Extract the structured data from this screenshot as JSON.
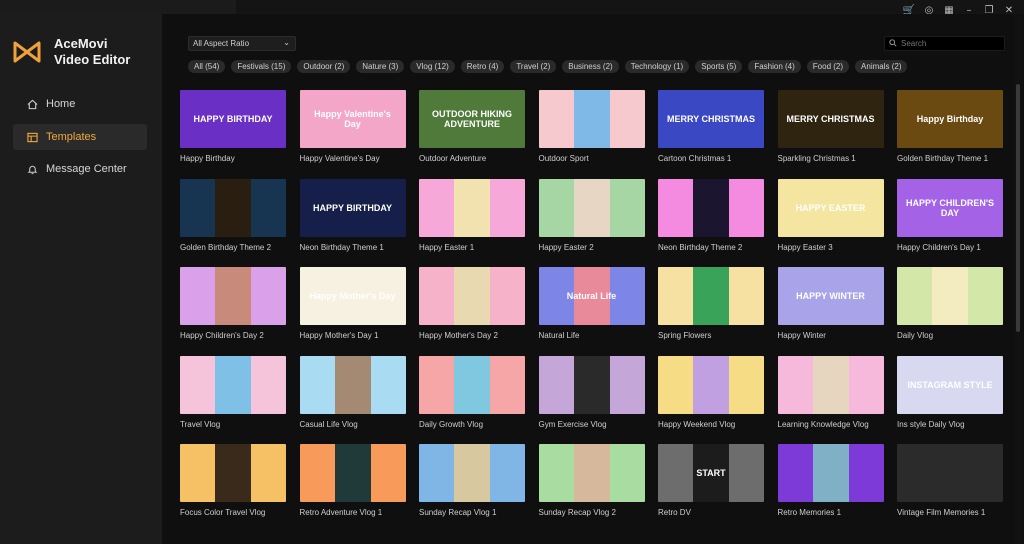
{
  "app": {
    "name_line1": "AceMovi",
    "name_line2": "Video Editor",
    "brand_color": "#f0a23a"
  },
  "window_controls": [
    "cart-icon",
    "account-icon",
    "grid-icon",
    "minimize-icon",
    "restore-icon",
    "close-icon"
  ],
  "sidebar": {
    "items": [
      {
        "label": "Home",
        "icon": "home-icon"
      },
      {
        "label": "Templates",
        "icon": "template-icon",
        "active": true
      },
      {
        "label": "Message Center",
        "icon": "bell-icon"
      }
    ]
  },
  "toolbar": {
    "aspect_ratio": "All Aspect Ratio",
    "search_placeholder": "Search"
  },
  "filters": [
    "All (54)",
    "Festivals (15)",
    "Outdoor (2)",
    "Nature (3)",
    "Vlog (12)",
    "Retro (4)",
    "Travel (2)",
    "Business (2)",
    "Technology (1)",
    "Sports (5)",
    "Fashion (4)",
    "Food (2)",
    "Animals (2)"
  ],
  "templates": [
    {
      "label": "Happy Birthday",
      "bg": "#6a2fc4",
      "center": null,
      "title": "HAPPY BIRTHDAY"
    },
    {
      "label": "Happy Valentine's Day",
      "bg": "#f3a6c8",
      "center": null,
      "title": "Happy Valentine's Day"
    },
    {
      "label": "Outdoor Adventure",
      "bg": "#4f7a3a",
      "center": null,
      "title": "OUTDOOR HIKING ADVENTURE"
    },
    {
      "label": "Outdoor Sport",
      "bg": "#f6c9cf",
      "center": "#7fb9e8",
      "title": ""
    },
    {
      "label": "Cartoon Christmas 1",
      "bg": "#3a48c4",
      "center": null,
      "title": "MERRY CHRISTMAS"
    },
    {
      "label": "Sparkling Christmas 1",
      "bg": "#2e2410",
      "center": null,
      "title": "MERRY CHRISTMAS"
    },
    {
      "label": "Golden Birthday Theme 1",
      "bg": "#6b4a12",
      "center": null,
      "title": "Happy Birthday"
    },
    {
      "label": "Golden Birthday Theme 2",
      "bg": "#173450",
      "center": "#2a1e10",
      "title": ""
    },
    {
      "label": "Neon Birthday Theme 1",
      "bg": "#151f4a",
      "center": null,
      "title": "HAPPY BIRTHDAY"
    },
    {
      "label": "Happy Easter 1",
      "bg": "#f6a9d9",
      "center": "#f2e2b0",
      "title": ""
    },
    {
      "label": "Happy Easter 2",
      "bg": "#a7d6a5",
      "center": "#e8d6c4",
      "title": ""
    },
    {
      "label": "Neon Birthday Theme 2",
      "bg": "#f58be0",
      "center": "#1c1530",
      "title": ""
    },
    {
      "label": "Happy Easter 3",
      "bg": "#f4e6a0",
      "center": null,
      "title": "HAPPY EASTER"
    },
    {
      "label": "Happy Children's Day 1",
      "bg": "#a463e6",
      "center": null,
      "title": "HAPPY CHILDREN'S DAY"
    },
    {
      "label": "Happy Children's Day 2",
      "bg": "#dba0ea",
      "center": "#c88a7a",
      "title": ""
    },
    {
      "label": "Happy Mother's Day 1",
      "bg": "#f6f1e0",
      "center": null,
      "title": "Happy Mother's Day"
    },
    {
      "label": "Happy Mother's Day 2",
      "bg": "#f6b2c8",
      "center": "#e9d9b0",
      "title": ""
    },
    {
      "label": "Natural Life",
      "bg": "#7d86e6",
      "center": "#e98a9a",
      "title": "Natural Life"
    },
    {
      "label": "Spring Flowers",
      "bg": "#f6e1a2",
      "center": "#3aa35a",
      "title": ""
    },
    {
      "label": "Happy Winter",
      "bg": "#a9a4ea",
      "center": null,
      "title": "HAPPY WINTER"
    },
    {
      "label": "Daily Vlog",
      "bg": "#d3e8a8",
      "center": "#f2ecc0",
      "title": ""
    },
    {
      "label": "Travel Vlog",
      "bg": "#f5c4da",
      "center": "#7fc0e6",
      "title": ""
    },
    {
      "label": "Casual Life Vlog",
      "bg": "#a9dcf2",
      "center": "#a48a72",
      "title": ""
    },
    {
      "label": "Daily Growth Vlog",
      "bg": "#f7a6a8",
      "center": "#7fc8e0",
      "title": ""
    },
    {
      "label": "Gym Exercise Vlog",
      "bg": "#c4a6d8",
      "center": "#2a2a2a",
      "title": ""
    },
    {
      "label": "Happy Weekend Vlog",
      "bg": "#f6dc84",
      "center": "#c0a0e0",
      "title": ""
    },
    {
      "label": "Learning Knowledge Vlog",
      "bg": "#f6b9dc",
      "center": "#e6d6c0",
      "title": ""
    },
    {
      "label": "Ins style Daily Vlog",
      "bg": "#d8d8f0",
      "center": null,
      "title": "INSTAGRAM STYLE"
    },
    {
      "label": "Focus Color Travel Vlog",
      "bg": "#f6c064",
      "center": "#3a2a1c",
      "title": ""
    },
    {
      "label": "Retro Adventure Vlog 1",
      "bg": "#f79a5a",
      "center": "#1f3a38",
      "title": ""
    },
    {
      "label": "Sunday Recap Vlog 1",
      "bg": "#7fb6e6",
      "center": "#d8c8a0",
      "title": ""
    },
    {
      "label": "Sunday Recap Vlog 2",
      "bg": "#a8dca0",
      "center": "#d6b89c",
      "title": ""
    },
    {
      "label": "Retro DV",
      "bg": "#6d6d6d",
      "center": "#1c1c1c",
      "title": "START"
    },
    {
      "label": "Retro Memories 1",
      "bg": "#7d3ad8",
      "center": "#7fb0c6",
      "title": ""
    },
    {
      "label": "Vintage Film Memories 1",
      "bg": "#2b2b2b",
      "center": null,
      "title": ""
    }
  ]
}
